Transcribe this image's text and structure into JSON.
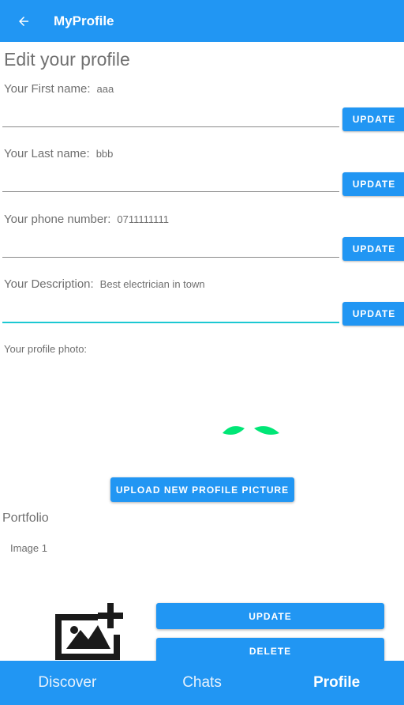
{
  "appbar": {
    "title": "MyProfile"
  },
  "heading": "Edit your profile",
  "fields": [
    {
      "label": "Your First name:",
      "value": "aaa",
      "button": "UPDATE"
    },
    {
      "label": "Your Last name:",
      "value": "bbb",
      "button": "UPDATE"
    },
    {
      "label": "Your phone number:",
      "value": "0711111111",
      "button": "UPDATE"
    },
    {
      "label": "Your Description:",
      "value": "Best electrician in town",
      "button": "UPDATE"
    }
  ],
  "photo": {
    "label": "Your profile photo:",
    "upload_button": "UPLOAD NEW PROFILE PICTURE"
  },
  "portfolio": {
    "title": "Portfolio",
    "image_label": "Image 1",
    "update_button": "UPDATE",
    "delete_button": "DELETE"
  },
  "bottom_nav": {
    "items": [
      "Discover",
      "Chats",
      "Profile"
    ],
    "selected": "Profile"
  },
  "colors": {
    "primary": "#2196f3",
    "focus_underline": "#1cc8d2",
    "spinner": "#00e676"
  },
  "icons": {
    "back": "arrow-left-icon",
    "add_image": "add-photo-icon"
  }
}
